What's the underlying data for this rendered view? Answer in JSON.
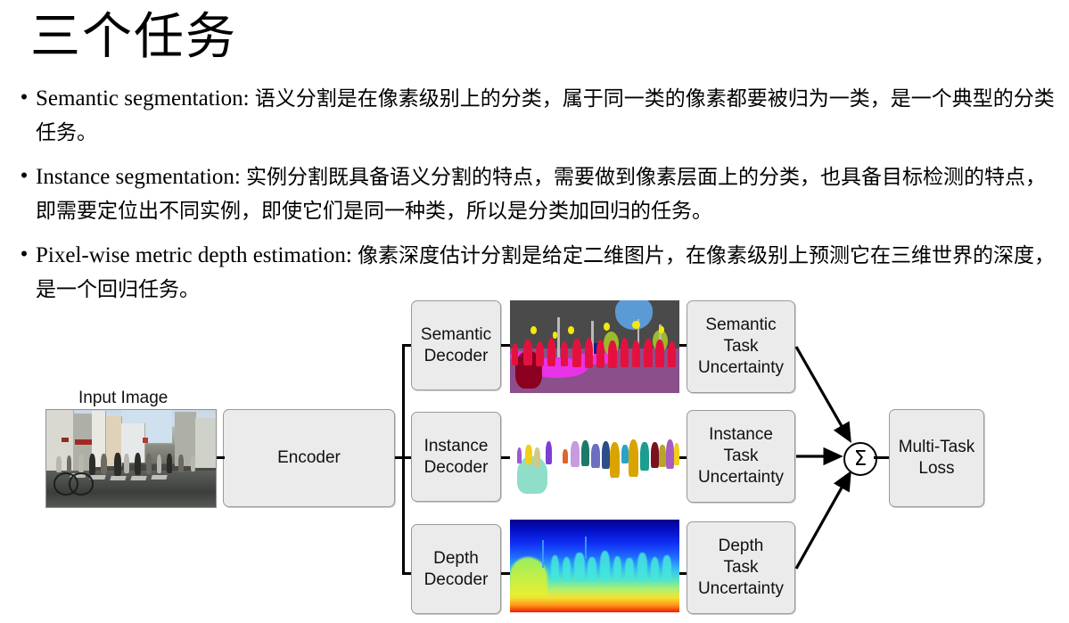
{
  "slide": {
    "title": "三个任务"
  },
  "bullets": [
    {
      "marker": "•",
      "term": "Semantic segmentation:",
      "text": "语义分割是在像素级别上的分类，属于同一类的像素都要被归为一类，是一个典型的分类任务。"
    },
    {
      "marker": "•",
      "term": "Instance segmentation:",
      "text": "实例分割既具备语义分割的特点，需要做到像素层面上的分类，也具备目标检测的特点，即需要定位出不同实例，即使它们是同一种类，所以是分类加回归的任务。"
    },
    {
      "marker": "•",
      "term": "Pixel-wise metric depth estimation:",
      "text": "像素深度估计分割是给定二维图片，在像素级别上预测它在三维世界的深度，是一个回归任务。"
    }
  ],
  "diagram": {
    "input_caption": "Input Image",
    "encoder": "Encoder",
    "decoders": [
      {
        "label": "Semantic\nDecoder"
      },
      {
        "label": "Instance\nDecoder"
      },
      {
        "label": "Depth\nDecoder"
      }
    ],
    "uncertainties": [
      {
        "label": "Semantic\nTask\nUncertainty"
      },
      {
        "label": "Instance\nTask\nUncertainty"
      },
      {
        "label": "Depth\nTask\nUncertainty"
      }
    ],
    "sum_symbol": "Σ",
    "loss": "Multi-Task\nLoss",
    "outputs": [
      {
        "name": "semantic-segmentation-map"
      },
      {
        "name": "instance-segmentation-map"
      },
      {
        "name": "depth-map"
      }
    ],
    "colors": {
      "node_fill": "#ebebeb",
      "node_border": "#9a9a9a",
      "wire": "#000000",
      "semantic_road": "#8b4f8b",
      "semantic_road_bright": "#e832e8",
      "semantic_building": "#4a4a4a",
      "semantic_person": "#e4113f",
      "semantic_sky": "#5b9bd5",
      "semantic_vegetation": "#9bbb2a",
      "semantic_car": "#0b1f96",
      "semantic_light": "#f2e80c",
      "depth_far": "#07008f",
      "depth_near": "#f21b07"
    },
    "instance_colors": [
      "#9b59d0",
      "#f2cf1b",
      "#cfc98a",
      "#7b3fd4",
      "#e2622b",
      "#c79be0",
      "#1d7a6a",
      "#6b6fc0",
      "#2b4f86",
      "#d9a300",
      "#2aa3c7",
      "#d9a300",
      "#1b9e8f",
      "#7a1020",
      "#b7a52a",
      "#a85cc0",
      "#f2cf1b",
      "#8fdec9"
    ]
  }
}
